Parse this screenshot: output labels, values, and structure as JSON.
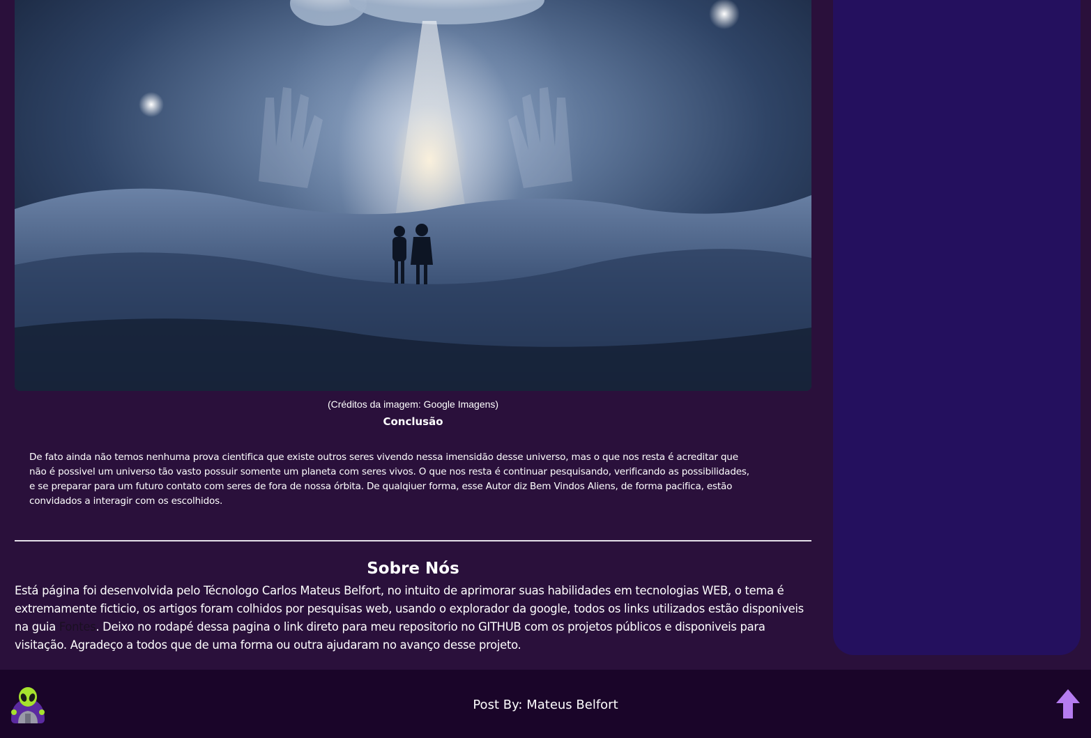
{
  "article": {
    "hero_image_alt": "Ilustração de duas crianças no deserto olhando para uma nave alienígena",
    "caption": "(Créditos da imagem: Google Imagens)",
    "conclusion_title": "Conclusão",
    "conclusion_lines": [
      "De fato ainda não temos nenhuma prova cientifica que existe outros seres vivendo nessa imensidão desse universo, mas o que nos resta é acreditar que",
      "não é possivel um universo tão vasto possuir somente um planeta com seres vivos. O que nos resta é continuar pesquisando, verificando as possibilidades,",
      "e se preparar para um futuro contato com seres de fora de nossa órbita. De qualqiuer forma, esse Autor diz Bem Vindos Aliens, de forma pacifica, estão",
      "convidados a interagir com os escolhidos."
    ]
  },
  "about": {
    "title": "Sobre Nós",
    "line1": "Está página foi desenvolvida pelo Técnologo Carlos Mateus Belfort, no intuito de aprimorar suas habilidades em tecnologias WEB, o tema é",
    "line2": "extremamente ficticio, os artigos foram colhidos por pesquisas web, usando o explorador da google, todos os links utilizados estão disponiveis",
    "line3_before": "na guia ",
    "link_label": "Fontes",
    "line3_after": ". Deixo no rodapé dessa pagina o link direto para meu repositorio no GITHUB com os projetos públicos e disponiveis para",
    "line4": "visitação. Agradeço a todos que de uma forma ou outra ajudaram no avanço desse projeto."
  },
  "footer": {
    "text": "Post By: Mateus Belfort",
    "logo_icon": "alien-logo-icon",
    "back_to_top_icon": "arrow-up-icon"
  },
  "colors": {
    "page_bg": "#2a103b",
    "sidebar_bg": "#24105e",
    "footer_bg": "#1a0529",
    "arrow": "#b57cf0",
    "alien_green": "#a6e22e"
  }
}
